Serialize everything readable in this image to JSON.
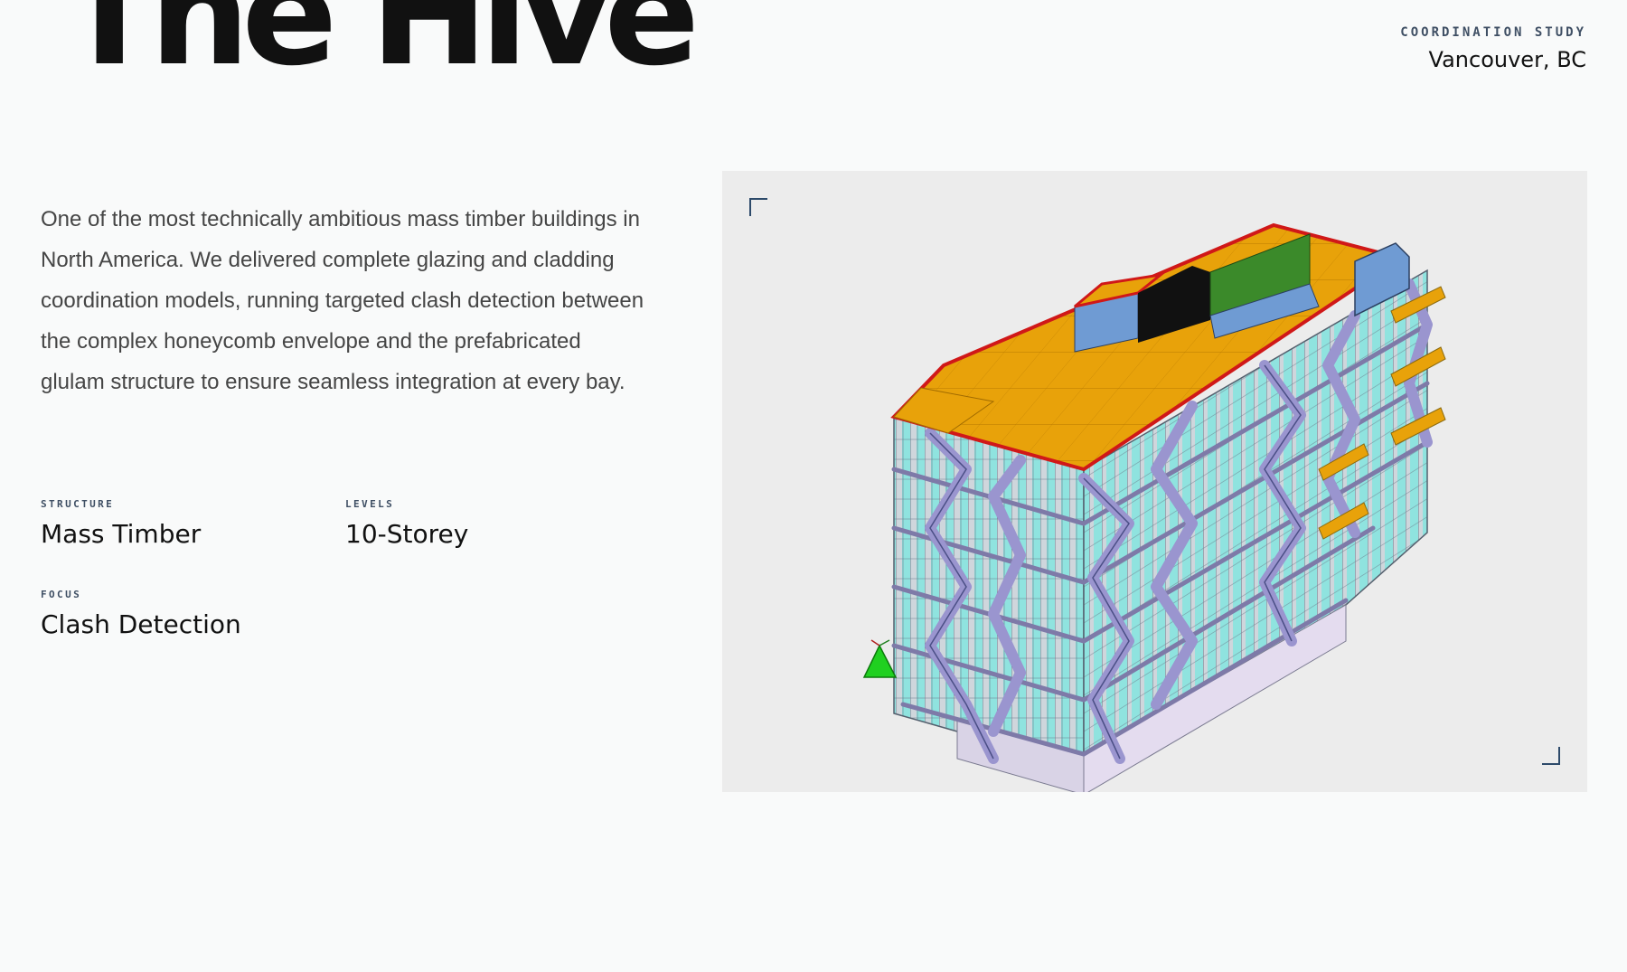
{
  "header": {
    "title": "The Hive",
    "eyebrow": "COORDINATION STUDY",
    "location": "Vancouver, BC"
  },
  "project": {
    "description": "One of the most technically ambitious mass timber buildings in North America. We delivered complete glazing and cladding coordination models, running targeted clash detection between the complex honeycomb envelope and the prefabricated glulam structure to ensure seamless integration at every bay.",
    "specs": [
      {
        "label": "STRUCTURE",
        "value": "Mass Timber"
      },
      {
        "label": "LEVELS",
        "value": "10-Storey"
      },
      {
        "label": "FOCUS",
        "value": "Clash Detection"
      }
    ]
  },
  "colors": {
    "accent": "#3f4f64",
    "roof": "#e8a20a",
    "roof_edge": "#d01818",
    "glazing": "#8fe3df",
    "frame": "#9a95cf",
    "marker": "#20d020"
  },
  "icons": {
    "corner_top_left": "bracket-corner-icon",
    "corner_bottom_right": "bracket-corner-icon",
    "model_marker": "triangle-marker-icon"
  }
}
